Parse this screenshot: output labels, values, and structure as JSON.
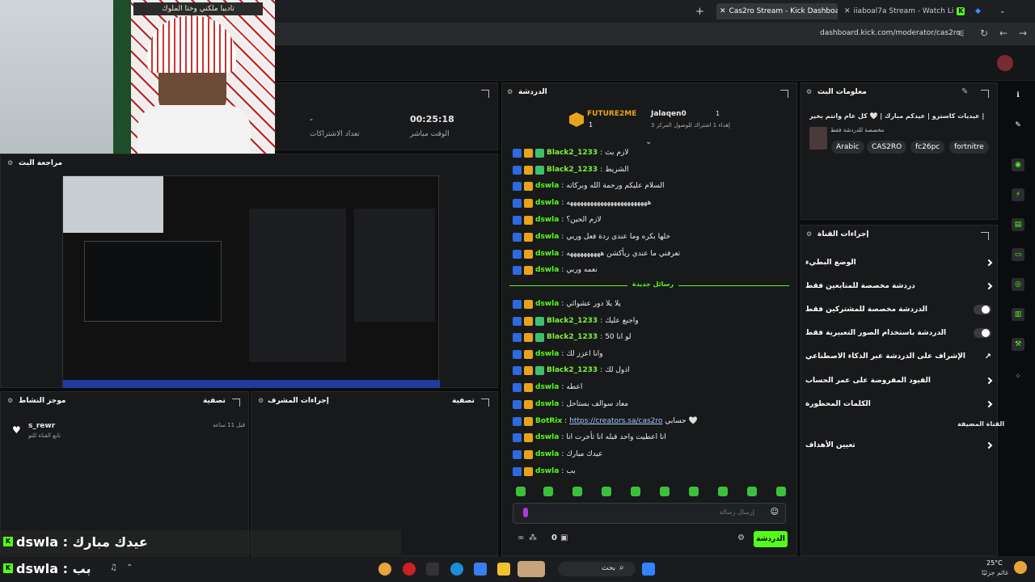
{
  "browser": {
    "tabs": [
      {
        "label": "Cas2ro Stream - Kick Dashboa"
      },
      {
        "label": "iiaboal7a Stream - Watch Li"
      }
    ],
    "url": "dashboard.kick.com/moderator/cas2ro",
    "new_tab_label": "+"
  },
  "webcam_banner": "تاديبا ملكني وختا الملوك",
  "stats": {
    "subs_label": "تعداد الاشتراكات",
    "subs_value": "-",
    "live_label": "الوقت مباشر",
    "live_value": "00:25:18"
  },
  "stream_review": {
    "title": "مراجعة البث"
  },
  "activity": {
    "title": "موجز النشاط",
    "filter": "تصفية",
    "items": [
      {
        "user": "s_rewr",
        "action": "تابع القناة للتو",
        "time": "قبل 11 ساعة"
      }
    ]
  },
  "mod_actions": {
    "title": "إجراءات المشرف",
    "filter": "تصفية"
  },
  "chat": {
    "title": "الدردشة",
    "pinned": [
      {
        "user": "FUTURE2ME",
        "count": "1"
      },
      {
        "user": "Jalaqen0",
        "count": "1",
        "note": "إهداء 1 اشتراك للوصول المركز 3"
      }
    ],
    "new_messages_label": "رسائل جديدة",
    "messages": [
      {
        "user": "Black2_1233",
        "text": "لازم بث",
        "badges": 3
      },
      {
        "user": "Black2_1233",
        "text": "الشريط",
        "badges": 3
      },
      {
        "user": "dswla",
        "text": "السلام عليكم ورحمة الله وبركاته",
        "badges": 2
      },
      {
        "user": "dswla",
        "text": "ههههههههههههههههههههههههه",
        "badges": 2
      },
      {
        "user": "dswla",
        "text": "لازم الحين؟",
        "badges": 2
      },
      {
        "user": "dswla",
        "text": "خلها بكره وما عندي ردة فعل وربي",
        "badges": 2
      },
      {
        "user": "dswla",
        "text": "تعرفني ما عندي ريأكشن ههههههههههه",
        "badges": 2
      },
      {
        "user": "dswla",
        "text": "نعمه وربي",
        "badges": 2
      },
      {
        "user": "dswla",
        "text": "يلا يلا دور عشوائي",
        "badges": 2
      },
      {
        "user": "Black2_1233",
        "text": "واجبع عليك",
        "badges": 3
      },
      {
        "user": "Black2_1233",
        "text": "لو انا 50",
        "badges": 3
      },
      {
        "user": "dswla",
        "text": "وانا اعزز لك",
        "badges": 2
      },
      {
        "user": "Black2_1233",
        "text": "اذول لك",
        "badges": 3
      },
      {
        "user": "dswla",
        "text": "اعطه",
        "badges": 2
      },
      {
        "user": "dswla",
        "text": "معاد سوالف بستاحل",
        "badges": 2
      },
      {
        "user": "BotRix",
        "link": "https://creators.sa/cas2ro",
        "text": "حسابي 🤍",
        "badges": 2
      },
      {
        "user": "dswla",
        "text": "انا اعطيت واحد قبله انا تأخرت انا",
        "badges": 2
      },
      {
        "user": "dswla",
        "text": "عيدك مبارك",
        "badges": 2
      },
      {
        "user": "dswla",
        "text": "بب",
        "badges": 2
      }
    ],
    "input_placeholder": "إرسال رسالة",
    "send_label": "الدردشة",
    "points": "0"
  },
  "stream_info": {
    "title": "معلومات البث",
    "stream_title": "عيديات كاسترو | عيدكم مبارك | 🤍 كل عام وانتم بخير |",
    "category": "مخصصة للدردشة فقط",
    "tags": [
      "Arabic",
      "CAS2RO",
      "fc26pc",
      "fortnitre"
    ]
  },
  "channel_actions": {
    "title": "إجراءات القناة",
    "items": [
      {
        "label": "الوضع البطيء",
        "type": "chevron"
      },
      {
        "label": "دردشة مخصصة للمتابعين فقط",
        "type": "chevron"
      },
      {
        "label": "الدردشة مخصصة للمشتركين فقط",
        "type": "toggle"
      },
      {
        "label": "الدردشة باستخدام الصور التعبيرية فقط",
        "type": "toggle"
      },
      {
        "label": "الإشراف على الدردشة عبر الذكاء الاصطناعي",
        "type": "external"
      },
      {
        "label": "القيود المفروضة على عمر الحساب",
        "type": "chevron"
      },
      {
        "label": "الكلمات المحظورة",
        "type": "chevron"
      }
    ],
    "section_label": "القناة المضيفة",
    "host_item": "تعيين الأهداف"
  },
  "overlay": {
    "line1": "dswla : عيدك مبارك",
    "line2": "dswla : بب"
  },
  "taskbar": {
    "search": "بحث",
    "weather_temp": "25°C",
    "weather_text": "غائم جزئيًا"
  }
}
